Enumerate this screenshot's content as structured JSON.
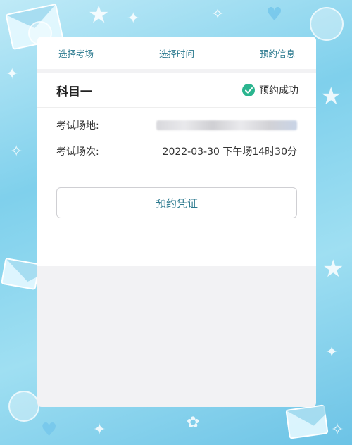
{
  "steps": [
    "选择考场",
    "选择时间",
    "预约信息"
  ],
  "subject": {
    "name": "科目一",
    "status": "预约成功",
    "status_color": "#2bb58f"
  },
  "info": {
    "venue_label": "考试场地:",
    "session_label": "考试场次:",
    "session_value": "2022-03-30 下午场14时30分"
  },
  "actions": {
    "voucher_button": "预约凭证"
  },
  "colors": {
    "accent": "#2c7a8f",
    "background": "#7fd0ec"
  }
}
